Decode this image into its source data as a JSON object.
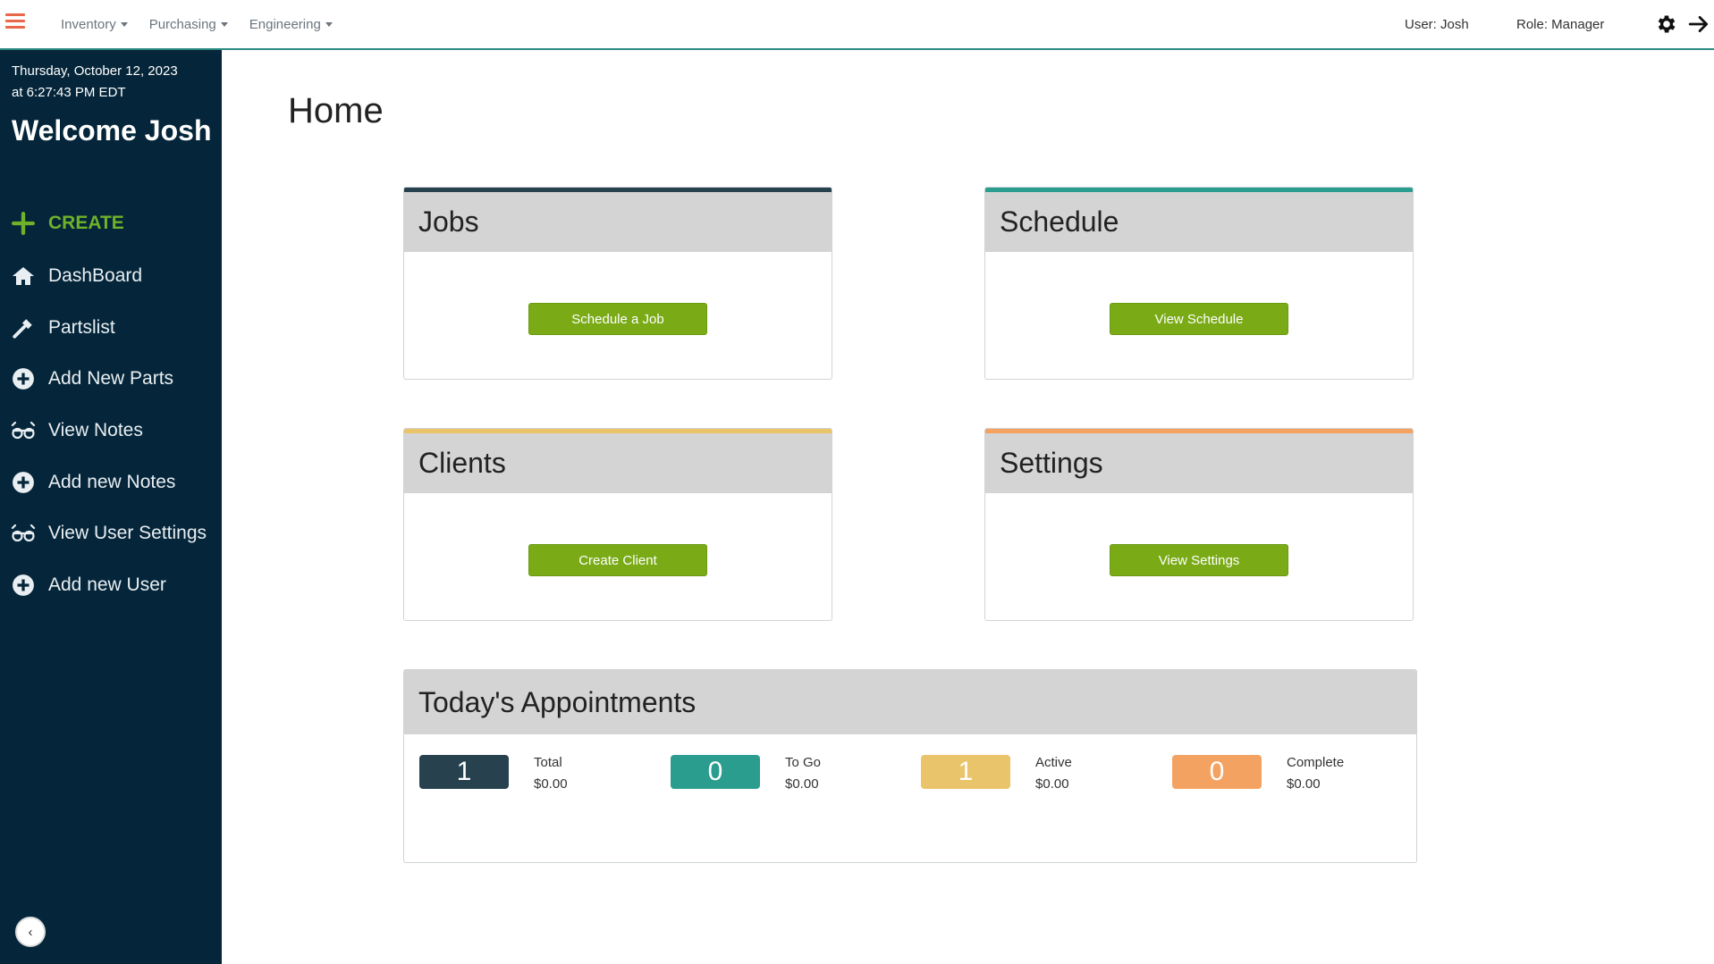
{
  "topbar": {
    "menu_items": [
      {
        "label": "Inventory"
      },
      {
        "label": "Purchasing"
      },
      {
        "label": "Engineering"
      }
    ],
    "user": "User: Josh",
    "role": "Role: Manager",
    "accent_color": "#2a8a80",
    "hamburger_color": "#e9684a",
    "icons": [
      "menu-icon",
      "gear-icon",
      "logout-arrow-icon"
    ]
  },
  "sidebar": {
    "date_line1": "Thursday, October 12, 2023",
    "date_line2": "at 6:27:43 PM EDT",
    "welcome": "Welcome Josh",
    "background": "#05263a",
    "items": [
      {
        "label": "CREATE",
        "icon": "plus-icon"
      },
      {
        "label": "DashBoard",
        "icon": "home-icon"
      },
      {
        "label": "Partslist",
        "icon": "hammer-icon"
      },
      {
        "label": "Add New Parts",
        "icon": "plus-circle-icon"
      },
      {
        "label": "View Notes",
        "icon": "glasses-icon"
      },
      {
        "label": "Add new Notes",
        "icon": "plus-circle-icon"
      },
      {
        "label": "View User Settings",
        "icon": "glasses-icon"
      },
      {
        "label": "Add new User",
        "icon": "plus-circle-icon"
      }
    ],
    "collapse_icon": "chevron-left-icon"
  },
  "main": {
    "title": "Home",
    "cards": [
      {
        "title": "Jobs",
        "button": "Schedule a Job",
        "accent": "#27414f"
      },
      {
        "title": "Schedule",
        "button": "View Schedule",
        "accent": "#2a9d8f"
      },
      {
        "title": "Clients",
        "button": "Create Client",
        "accent": "#e9c46a"
      },
      {
        "title": "Settings",
        "button": "View Settings",
        "accent": "#f4a261"
      }
    ],
    "button_color": "#7aab17",
    "appointments": {
      "title": "Today's Appointments",
      "stats": [
        {
          "count": "1",
          "label": "Total",
          "amount": "$0.00",
          "color": "#27414f"
        },
        {
          "count": "0",
          "label": "To Go",
          "amount": "$0.00",
          "color": "#2a9d8f"
        },
        {
          "count": "1",
          "label": "Active",
          "amount": "$0.00",
          "color": "#e9c46a"
        },
        {
          "count": "0",
          "label": "Complete",
          "amount": "$0.00",
          "color": "#f4a261"
        }
      ]
    }
  }
}
